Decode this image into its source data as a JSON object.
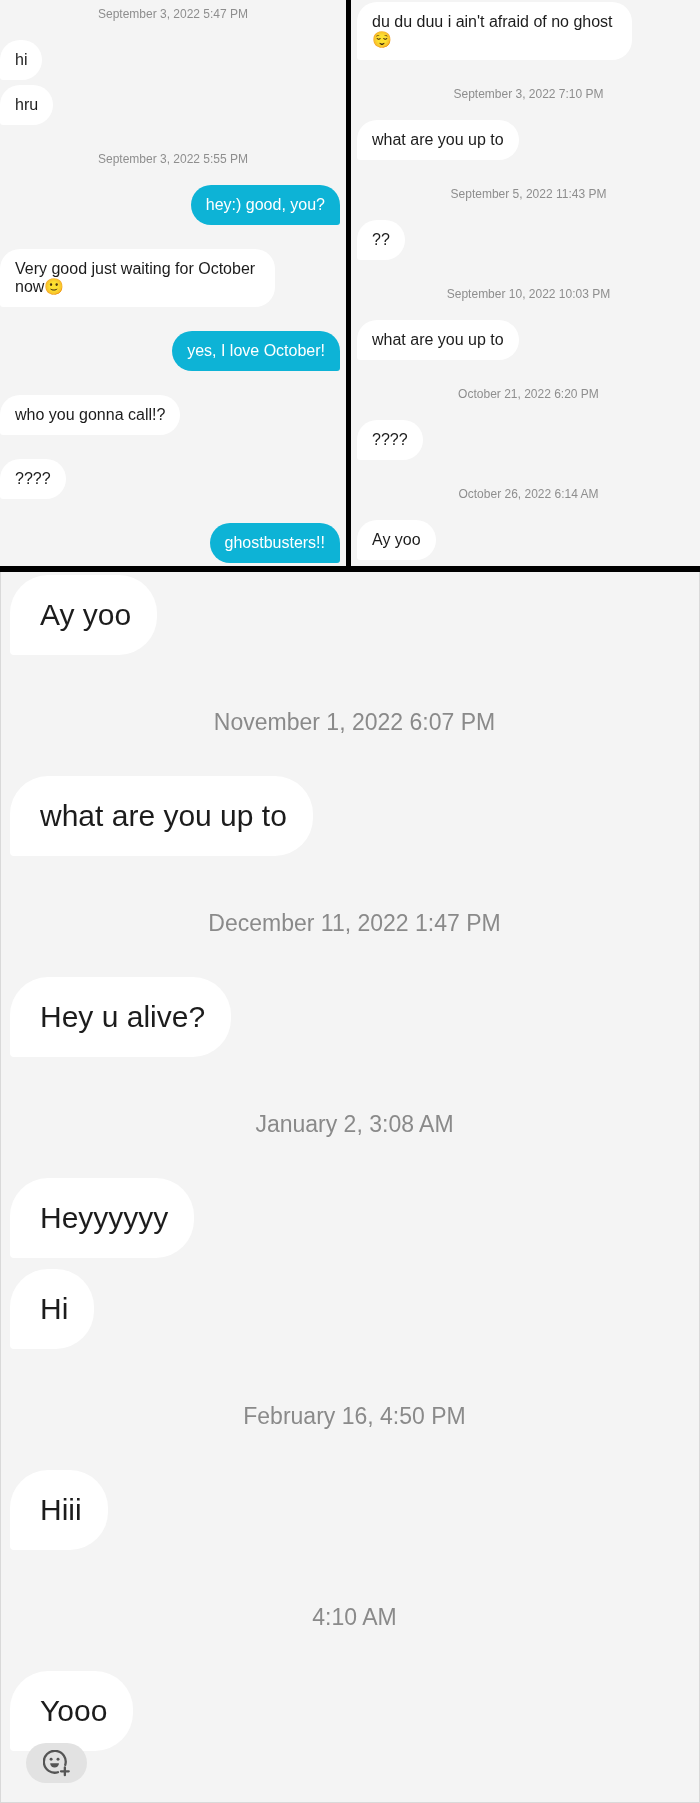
{
  "top_left": {
    "items": [
      {
        "kind": "timestamp",
        "text": "September 3, 2022 5:47 PM"
      },
      {
        "kind": "received",
        "messages": [
          "hi",
          "hru"
        ]
      },
      {
        "kind": "timestamp",
        "text": "September 3, 2022 5:55 PM"
      },
      {
        "kind": "sent",
        "messages": [
          "hey:) good, you?"
        ]
      },
      {
        "kind": "received",
        "messages": [
          "Very good just waiting for October now🙂"
        ]
      },
      {
        "kind": "sent",
        "messages": [
          "yes, I love October!"
        ]
      },
      {
        "kind": "received",
        "messages": [
          "who you gonna call!?"
        ]
      },
      {
        "kind": "received",
        "messages": [
          "????"
        ]
      },
      {
        "kind": "sent",
        "messages": [
          "ghostbusters!!"
        ]
      }
    ]
  },
  "top_right": {
    "items": [
      {
        "kind": "received",
        "messages": [
          "du du duu i ain't afraid of no ghost 😌"
        ]
      },
      {
        "kind": "timestamp",
        "text": "September 3, 2022 7:10 PM"
      },
      {
        "kind": "received",
        "messages": [
          "what are you up to"
        ]
      },
      {
        "kind": "timestamp",
        "text": "September 5, 2022 11:43 PM"
      },
      {
        "kind": "received",
        "messages": [
          "??"
        ]
      },
      {
        "kind": "timestamp",
        "text": "September 10, 2022 10:03 PM"
      },
      {
        "kind": "received",
        "messages": [
          "what are you up to"
        ]
      },
      {
        "kind": "timestamp",
        "text": "October 21, 2022 6:20 PM"
      },
      {
        "kind": "received",
        "messages": [
          "????"
        ]
      },
      {
        "kind": "timestamp",
        "text": "October 26, 2022 6:14 AM"
      },
      {
        "kind": "received",
        "messages": [
          "Ay yoo"
        ]
      }
    ]
  },
  "bottom": {
    "items": [
      {
        "kind": "received",
        "messages": [
          "Ay yoo"
        ]
      },
      {
        "kind": "timestamp",
        "text": "November 1, 2022 6:07 PM"
      },
      {
        "kind": "received",
        "messages": [
          "what are you up to"
        ]
      },
      {
        "kind": "timestamp",
        "text": "December 11, 2022 1:47 PM"
      },
      {
        "kind": "received",
        "messages": [
          "Hey u alive?"
        ]
      },
      {
        "kind": "timestamp",
        "text": "January 2, 3:08 AM"
      },
      {
        "kind": "received",
        "messages": [
          "Heyyyyyy",
          "Hi"
        ]
      },
      {
        "kind": "timestamp",
        "text": "February 16, 4:50 PM"
      },
      {
        "kind": "received",
        "messages": [
          "Hiii"
        ]
      },
      {
        "kind": "timestamp",
        "text": "4:10 AM"
      },
      {
        "kind": "received",
        "messages": [
          "Yooo"
        ],
        "add_reaction": true
      }
    ]
  }
}
